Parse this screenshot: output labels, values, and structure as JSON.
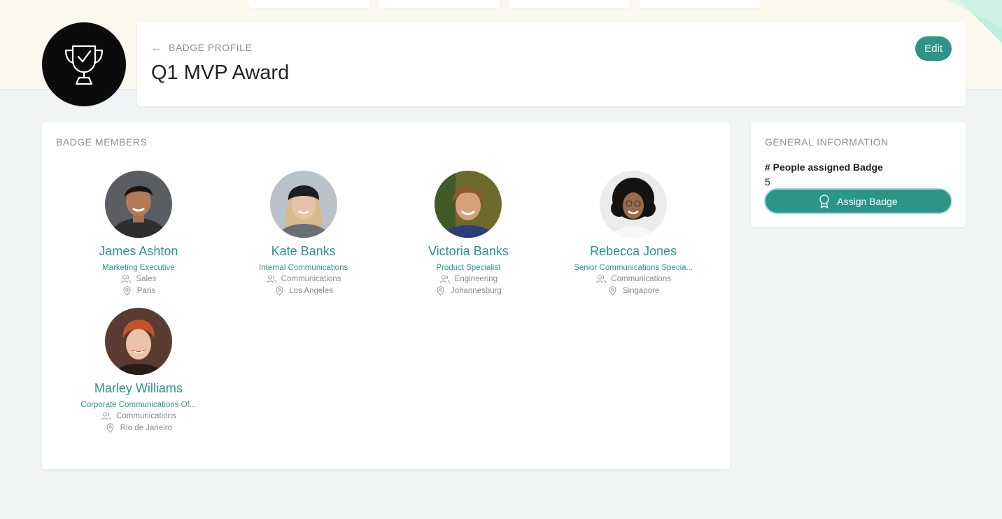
{
  "header": {
    "back_label": "BADGE PROFILE",
    "title": "Q1 MVP Award",
    "edit_label": "Edit"
  },
  "members_section": {
    "heading": "BADGE MEMBERS",
    "members": [
      {
        "name": "James Ashton",
        "title": "Marketing Executive",
        "department": "Sales",
        "location": "Paris"
      },
      {
        "name": "Kate Banks",
        "title": "Internal Communications",
        "department": "Communications",
        "location": "Los Angeles"
      },
      {
        "name": "Victoria Banks",
        "title": "Product Specialist",
        "department": "Engineering",
        "location": "Johannesburg"
      },
      {
        "name": "Rebecca Jones",
        "title": "Senior Communications Specia...",
        "department": "Communications",
        "location": "Singapore"
      },
      {
        "name": "Marley Williams",
        "title": "Corporate Communications Of...",
        "department": "Communications",
        "location": "Rio de Janeiro"
      }
    ]
  },
  "general_info": {
    "heading": "GENERAL INFORMATION",
    "people_label": "# People assigned Badge",
    "people_count": "5",
    "assign_label": "Assign Badge"
  },
  "colors": {
    "accent": "#2d9488",
    "badge_bg": "#0b0b0b",
    "page_bg": "#f1f4f5",
    "top_band": "#fbf8f0"
  },
  "icons": {
    "badge": "trophy-check-icon",
    "back": "arrow-left-icon",
    "department": "people-icon",
    "location": "map-pin-icon",
    "assign": "award-icon"
  }
}
